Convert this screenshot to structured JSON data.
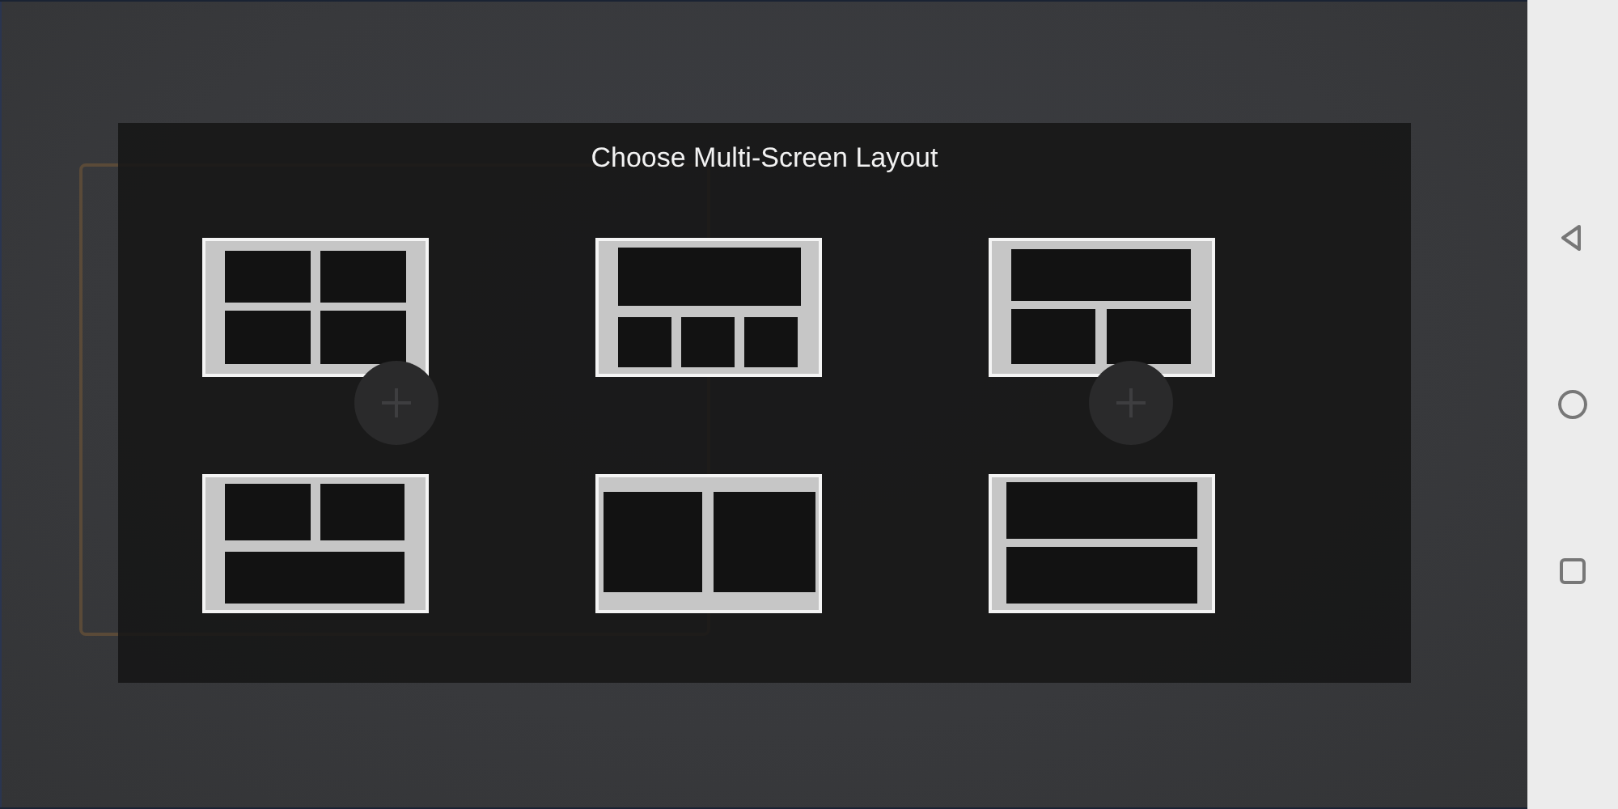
{
  "dialog": {
    "title": "Choose Multi-Screen Layout"
  },
  "layouts": [
    {
      "kind": "grid4"
    },
    {
      "kind": "top1-bottom3"
    },
    {
      "kind": "top1-bottom2"
    },
    {
      "kind": "top2-bottom1"
    },
    {
      "kind": "two-columns"
    },
    {
      "kind": "two-rows"
    }
  ],
  "nav_buttons": [
    {
      "kind": "back"
    },
    {
      "kind": "home"
    },
    {
      "kind": "recents"
    }
  ]
}
